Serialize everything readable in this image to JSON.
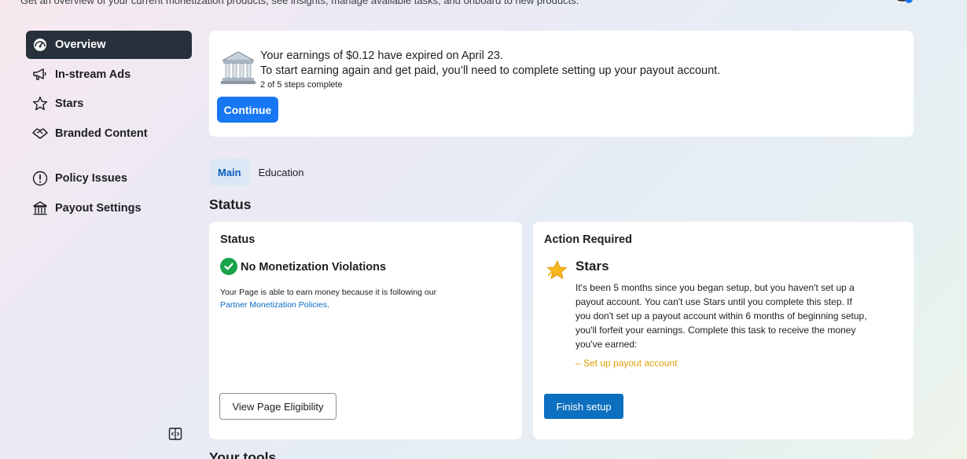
{
  "header": {
    "subtitle": "Get an overview of your current monetization products, see insights, manage available tasks, and onboard to new products."
  },
  "sidebar": {
    "items": [
      {
        "label": "Overview",
        "icon": "dashboard-icon"
      },
      {
        "label": "In-stream Ads",
        "icon": "megaphone-icon"
      },
      {
        "label": "Stars",
        "icon": "star-icon"
      },
      {
        "label": "Branded Content",
        "icon": "handshake-icon"
      }
    ],
    "items2": [
      {
        "label": "Policy Issues",
        "icon": "alert-circle-icon"
      },
      {
        "label": "Payout Settings",
        "icon": "bank-icon"
      }
    ]
  },
  "banner": {
    "line1": "Your earnings of $0.12 have expired on April 23.",
    "line2": "To start earning again and get paid, you’ll need to complete setting up your payout account.",
    "steps": "2 of 5 steps complete",
    "button": "Continue"
  },
  "tabs": [
    "Main",
    "Education"
  ],
  "section_title": "Status",
  "status_card": {
    "heading": "Status",
    "status": "No Monetization Violations",
    "desc": "Your Page is able to earn money because it is following our",
    "link": "Partner Monetization Policies",
    "link_suffix": ".",
    "button": "View Page Eligibility"
  },
  "action_card": {
    "heading": "Action Required",
    "title": "Stars",
    "desc": "It's been 5 months since you began setup, but you haven't set up a payout account. You can't use Stars until you complete this step. If you don't set up a payout account within 6 months of beginning setup, you'll forfeit your earnings. Complete this task to receive the money you've earned:",
    "link": "– Set up payout account",
    "button": "Finish setup"
  },
  "bottom_title": "Your tools",
  "colors": {
    "accent": "#1877f2",
    "active_nav": "#27313b",
    "success": "#1aa34a",
    "warning_link": "#e0a106"
  }
}
